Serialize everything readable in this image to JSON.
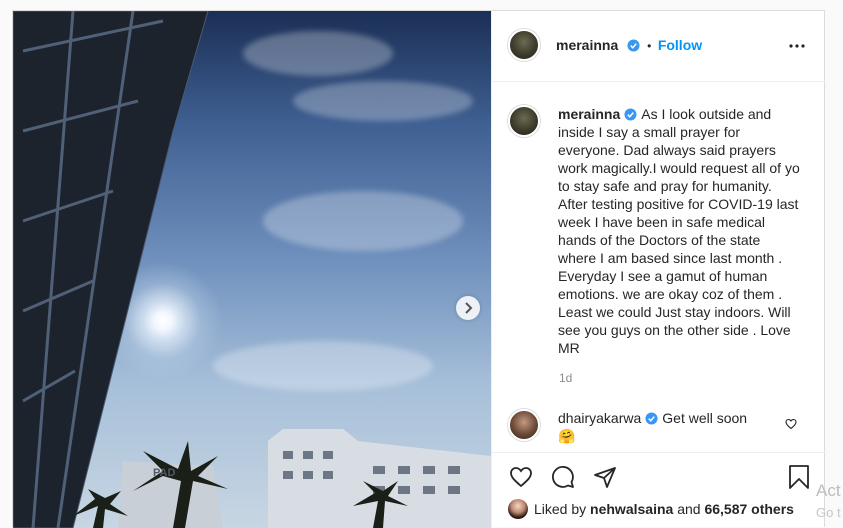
{
  "post": {
    "username": "merainna",
    "follow_label": "Follow",
    "separator": "•",
    "caption": "As I look outside and inside I say a small prayer for everyone. Dad always said prayers work magically.I would request all of yo to stay safe and pray for humanity. After testing positive for COVID-19 last week I have been in safe medical hands of the Doctors of the state where I am based since last month . Everyday I see a gamut of human emotions. we are okay coz of them . Least we could Just stay indoors. Will see you guys on the other side . Love MR",
    "time_ago": "1d",
    "photo_sign_text": "PAD"
  },
  "comment": {
    "username": "dhairyakarwa",
    "text": "Get well soon",
    "emoji": "🤗"
  },
  "likes": {
    "prefix": "Liked by",
    "user": "nehwalsaina",
    "middle": "and",
    "count_text": "66,587 others"
  },
  "watermark": {
    "line1": "Act",
    "line2": "Go t"
  },
  "colors": {
    "follow_blue": "#0095f6",
    "verified_blue": "#3897f0",
    "muted_gray": "#8e8e8e"
  },
  "icons": [
    "verified-badge-icon",
    "more-options-icon",
    "chevron-right-icon",
    "heart-icon",
    "comment-icon",
    "share-icon",
    "bookmark-icon"
  ]
}
